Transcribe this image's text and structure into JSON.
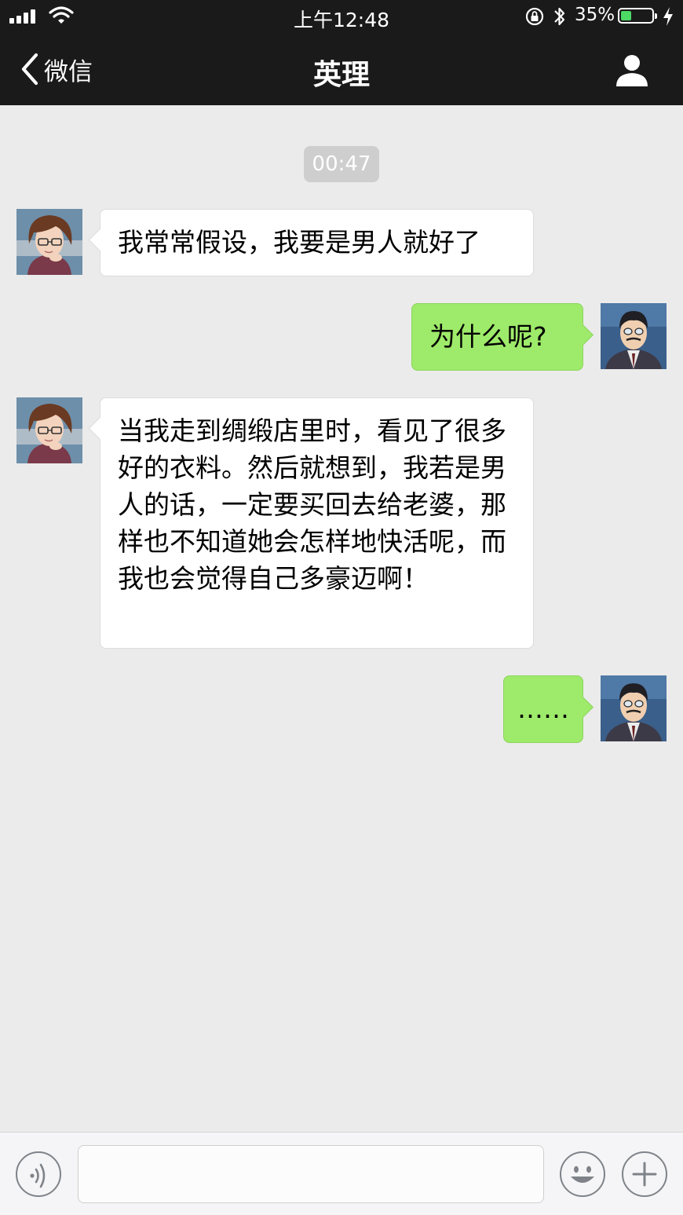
{
  "status_bar": {
    "time": "上午12:48",
    "battery_percent": "35%",
    "battery_level": 0.35,
    "battery_color": "#4cd964"
  },
  "nav": {
    "back_label": "微信",
    "title": "英理",
    "back_icon": "chevron-left-icon",
    "profile_icon": "person-icon"
  },
  "chat": {
    "timestamp": "00:47",
    "messages": [
      {
        "side": "in",
        "text": "我常常假设，我要是男人就好了"
      },
      {
        "side": "out",
        "text": "为什么呢?"
      },
      {
        "side": "in",
        "text": "当我走到绸缎店里时，看见了很多好的衣料。然后就想到，我若是男人的话，一定要买回去给老婆，那样也不知道她会怎样地快活呢，而我也会觉得自己多豪迈啊！"
      },
      {
        "side": "out",
        "text": "……"
      }
    ]
  },
  "input_bar": {
    "voice_icon": "voice-icon",
    "emoji_icon": "emoji-icon",
    "plus_icon": "plus-icon",
    "text_value": ""
  },
  "colors": {
    "bar_bg": "#1a1a1a",
    "chat_bg": "#ebebeb",
    "out_bubble": "#9eea6a",
    "in_bubble": "#ffffff"
  }
}
